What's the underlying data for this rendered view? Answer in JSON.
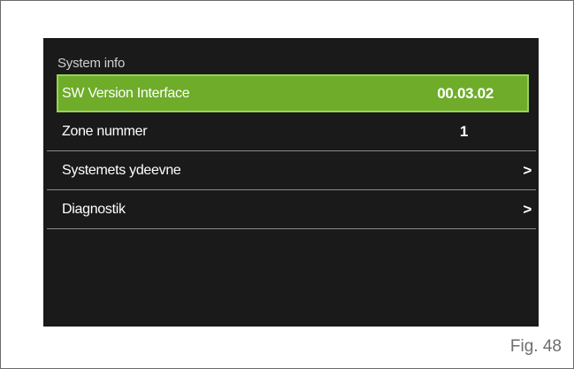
{
  "screen": {
    "title": "System info",
    "menu": [
      {
        "label": "SW Version Interface",
        "value": "00.03.02",
        "selected": true
      },
      {
        "label": "Zone nummer",
        "value": "1"
      },
      {
        "label": "Systemets ydeevne",
        "value": ">"
      },
      {
        "label": "Diagnostik",
        "value": ">"
      }
    ]
  },
  "caption": "Fig. 48",
  "colors": {
    "screen_background": "#1a1a1a",
    "selection_fill": "#6eac2a",
    "selection_border": "#9ad25a",
    "text": "#ffffff"
  }
}
